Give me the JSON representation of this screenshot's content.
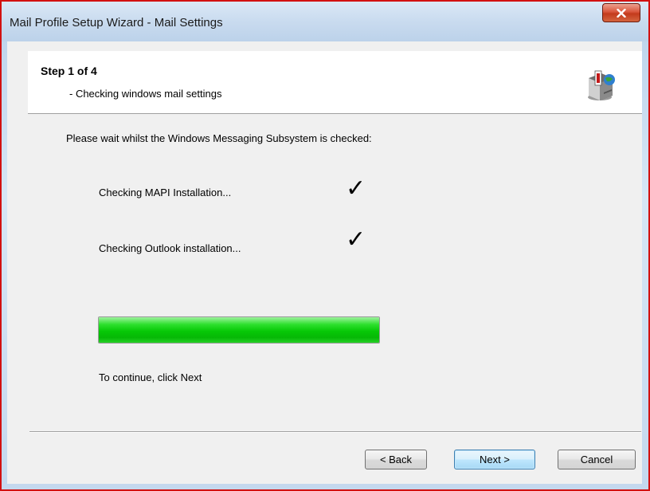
{
  "window": {
    "title": "Mail Profile Setup Wizard - Mail Settings",
    "close_icon": "close-icon"
  },
  "header": {
    "step_title": "Step 1 of 4",
    "step_subtitle": "- Checking windows mail settings",
    "icon": "mail-server-icon"
  },
  "body": {
    "intro": "Please wait whilst the Windows Messaging Subsystem is checked:",
    "checks": [
      {
        "label": "Checking MAPI Installation...",
        "status": "✓",
        "done": true
      },
      {
        "label": "Checking Outlook installation...",
        "status": "✓",
        "done": true
      }
    ],
    "progress": {
      "value_percent": 100,
      "color": "#06c106"
    },
    "continue_text": "To continue, click Next"
  },
  "buttons": {
    "back": "< Back",
    "next": "Next >",
    "cancel": "Cancel"
  },
  "colors": {
    "window_border": "#d21010",
    "dialog_background": "#f0f0f0",
    "header_background": "#ffffff",
    "default_button_border": "#3c7fb1"
  }
}
